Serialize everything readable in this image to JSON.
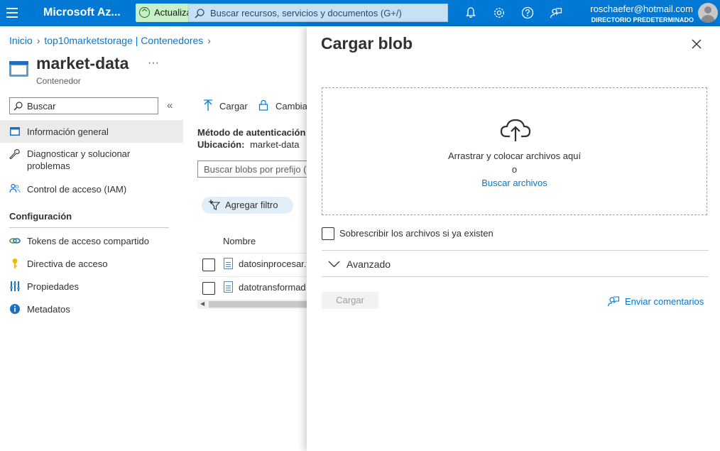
{
  "topbar": {
    "brand": "Microsoft Az...",
    "update_label": "Actualiza",
    "search_placeholder": "Buscar recursos, servicios y documentos (G+/)",
    "user_email": "roschaefer@hotmail.com",
    "user_directory": "DIRECTORIO PREDETERMINADO"
  },
  "breadcrumb": [
    "Inicio",
    "top10marketstorage | Contenedores"
  ],
  "page": {
    "title": "market-data",
    "subtitle": "Contenedor",
    "more": "···"
  },
  "nav": {
    "search_placeholder": "Buscar",
    "items": [
      {
        "label": "Información general",
        "icon": "overview-icon"
      },
      {
        "label_line1": "Diagnosticar y solucionar",
        "label_line2": "problemas",
        "icon": "wrench-icon"
      },
      {
        "label": "Control de acceso (IAM)",
        "icon": "people-icon"
      }
    ],
    "section": "Configuración",
    "config_items": [
      {
        "label": "Tokens de acceso compartido",
        "icon": "link-icon"
      },
      {
        "label": "Directiva de acceso",
        "icon": "key-icon"
      },
      {
        "label": "Propiedades",
        "icon": "properties-icon"
      },
      {
        "label": "Metadatos",
        "icon": "info-icon"
      }
    ]
  },
  "middle": {
    "cmd_upload": "Cargar",
    "cmd_change": "Cambia",
    "auth_label": "Método de autenticación",
    "location_label": "Ubicación:",
    "location_value": "market-data",
    "blob_search_placeholder": "Buscar blobs por prefijo (",
    "filter_label": "Agregar filtro",
    "col_name": "Nombre",
    "files": [
      "datosinprocesar.t",
      "datotransformad"
    ]
  },
  "blade": {
    "title": "Cargar blob",
    "drop_text": "Arrastrar y colocar archivos aquí",
    "or_text": "o",
    "browse_link": "Buscar archivos",
    "overwrite_label": "Sobrescribir los archivos si ya existen",
    "advanced_label": "Avanzado",
    "upload_button": "Cargar",
    "feedback_label": "Enviar comentarios"
  },
  "colors": {
    "topbar": "#0078d4",
    "link": "#0078d4",
    "update_pill": "#c8f0c8",
    "search_bg": "#c7e0f4"
  }
}
